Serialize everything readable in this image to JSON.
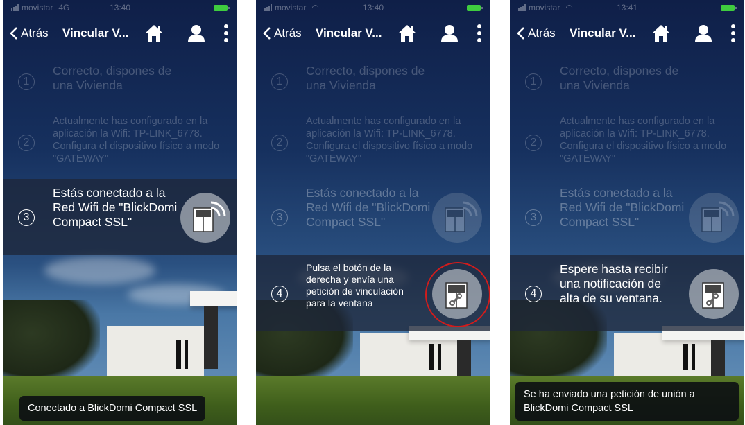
{
  "screens": [
    {
      "status": {
        "carrier": "movistar",
        "network": "4G",
        "time": "13:40"
      },
      "nav": {
        "back_label": "Atrás",
        "title": "Vincular V..."
      },
      "steps": [
        {
          "num": "1",
          "text": "Correcto, dispones de una Vivienda"
        },
        {
          "num": "2",
          "text": "Actualmente has configurado en la aplicación la Wifi: TP-LINK_6778. Configura el dispositivo físico a modo \"GATEWAY\""
        },
        {
          "num": "3",
          "text": "Estás conectado a la Red Wifi de \"BlickDomi Compact SSL\""
        }
      ],
      "toast": "Conectado a BlickDomi Compact SSL"
    },
    {
      "status": {
        "carrier": "movistar",
        "time": "13:40"
      },
      "nav": {
        "back_label": "Atrás",
        "title": "Vincular V..."
      },
      "steps": [
        {
          "num": "1",
          "text": "Correcto, dispones de una Vivienda"
        },
        {
          "num": "2",
          "text": "Actualmente has configurado en la aplicación la Wifi: TP-LINK_6778. Configura el dispositivo físico a modo \"GATEWAY\""
        },
        {
          "num": "3",
          "text": "Estás conectado a la Red Wifi de \"BlickDomi Compact SSL\""
        },
        {
          "num": "4",
          "text": "Pulsa el botón de la derecha y envía una petición de vinculación para la ventana"
        }
      ]
    },
    {
      "status": {
        "carrier": "movistar",
        "time": "13:41"
      },
      "nav": {
        "back_label": "Atrás",
        "title": "Vincular V..."
      },
      "steps": [
        {
          "num": "1",
          "text": "Correcto, dispones de una Vivienda"
        },
        {
          "num": "2",
          "text": "Actualmente has configurado en la aplicación la Wifi: TP-LINK_6778. Configura el dispositivo físico a modo \"GATEWAY\""
        },
        {
          "num": "3",
          "text": "Estás conectado a la Red Wifi de \"BlickDomi Compact SSL\""
        },
        {
          "num": "4",
          "text": "Espere hasta recibir una notificación de alta de su ventana."
        }
      ],
      "toast": "Se ha enviado una petición de unión a BlickDomi Compact SSL"
    }
  ],
  "icons": {
    "back": "chevron-left-icon",
    "home": "home-icon",
    "user": "user-icon",
    "more": "more-vertical-icon",
    "device_wifi": "window-wifi-icon",
    "device_link": "window-link-icon"
  },
  "colors": {
    "battery": "#3fcc3f",
    "highlight_ring": "#d11c1c"
  }
}
